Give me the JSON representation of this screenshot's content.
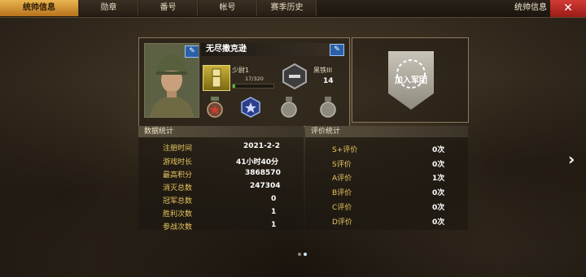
{
  "tabs": [
    {
      "label": "统帅信息",
      "active": true
    },
    {
      "label": "勋章",
      "active": false
    },
    {
      "label": "番号",
      "active": false
    },
    {
      "label": "帐号",
      "active": false
    },
    {
      "label": "赛季历史",
      "active": false
    }
  ],
  "header": {
    "title": "统帅信息",
    "close_icon": "close-icon"
  },
  "profile": {
    "name": "无尽撒克逊",
    "rank": "少尉1",
    "xp": "17/320",
    "xp_progress": 0.053,
    "tier": "黑铁III",
    "tier_value": "14"
  },
  "join": {
    "label": "加入军团"
  },
  "stats": {
    "title": "数据统计",
    "rows": [
      {
        "label": "注册时间",
        "value": "2021-2-2"
      },
      {
        "label": "游戏时长",
        "value": "41小时40分"
      },
      {
        "label": "最高积分",
        "value": "3868570"
      },
      {
        "label": "消灭总数",
        "value": "247304"
      },
      {
        "label": "冠军总数",
        "value": "0"
      },
      {
        "label": "胜利次数",
        "value": "1"
      },
      {
        "label": "参战次数",
        "value": "1"
      }
    ]
  },
  "ratings": {
    "title": "评价统计",
    "rows": [
      {
        "label": "S+评价",
        "value": "0次"
      },
      {
        "label": "S评价",
        "value": "0次"
      },
      {
        "label": "A评价",
        "value": "1次"
      },
      {
        "label": "B评价",
        "value": "0次"
      },
      {
        "label": "C评价",
        "value": "0次"
      },
      {
        "label": "D评价",
        "value": "0次"
      }
    ]
  },
  "pager": {
    "arrow": "›",
    "pages": 2,
    "current": 2
  }
}
